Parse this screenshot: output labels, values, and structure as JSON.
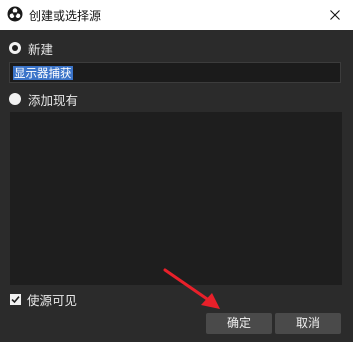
{
  "window": {
    "title": "创建或选择源",
    "icons": {
      "app": "obs-logo-icon",
      "close": "close-icon"
    }
  },
  "create_new": {
    "label": "新建",
    "selected": true,
    "name_value": "显示器捕获"
  },
  "add_existing": {
    "label": "添加现有",
    "selected": false
  },
  "make_visible": {
    "label": "使源可见",
    "checked": true
  },
  "buttons": {
    "ok": "确定",
    "cancel": "取消"
  },
  "colors": {
    "background": "#2b2b2b",
    "list_background": "#1e1e1e",
    "selection": "#3b74c9",
    "annotation_arrow": "#e8202a"
  }
}
